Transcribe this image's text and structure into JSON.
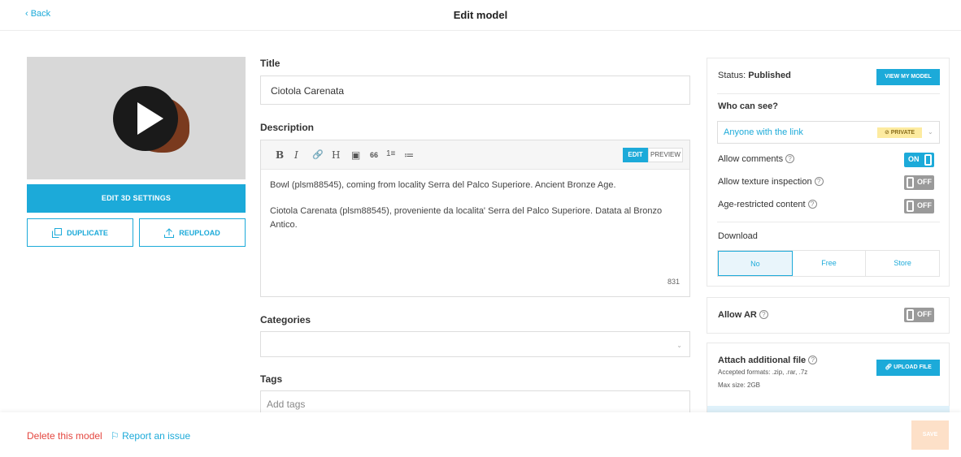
{
  "header": {
    "back_label": "‹ Back",
    "title": "Edit model"
  },
  "left": {
    "edit3d_label": "EDIT 3D SETTINGS",
    "duplicate_label": "DUPLICATE",
    "reupload_label": "REUPLOAD"
  },
  "form": {
    "title_label": "Title",
    "title_value": "Ciotola Carenata",
    "description_label": "Description",
    "toolbar": {
      "bold": "B",
      "italic": "I",
      "link": "🔗",
      "heading": "H",
      "image": "▣",
      "quote": "66",
      "ordered": "1≡",
      "bullets": "≔",
      "edit": "EDIT",
      "preview": "PREVIEW"
    },
    "description_p1": "Bowl (plsm88545), coming from locality Serra del Palco Superiore. Ancient Bronze Age.",
    "description_p2": "Ciotola Carenata (plsm88545), proveniente da localita' Serra del Palco Superiore. Datata al Bronzo Antico.",
    "char_count": "831",
    "categories_label": "Categories",
    "tags_label": "Tags",
    "tags_placeholder": "Add tags"
  },
  "right": {
    "status_prefix": "Status: ",
    "status_value": "Published",
    "view_model_label": "VIEW MY MODEL",
    "who_label": "Who can see?",
    "who_value": "Anyone with the link",
    "private_badge": "PRIVATE",
    "allow_comments": "Allow comments",
    "allow_texture": "Allow texture inspection",
    "age_restricted": "Age-restricted content",
    "on_label": "ON",
    "off_label": "OFF",
    "download_label": "Download",
    "download_options": [
      "No",
      "Free",
      "Store"
    ],
    "allow_ar": "Allow AR",
    "attach_label": "Attach additional file",
    "accepted_formats": "Accepted formats: .zip, .rar, .7z",
    "max_size": "Max size: 2GB",
    "upload_file_label": "UPLOAD FILE",
    "help_glyph": "?"
  },
  "footer": {
    "delete_label": "Delete this model",
    "report_label": "Report an issue",
    "save_label": "SAVE"
  },
  "colors": {
    "accent": "#1caad9",
    "danger": "#e4463f",
    "save_disabled": "#fde0c8"
  }
}
